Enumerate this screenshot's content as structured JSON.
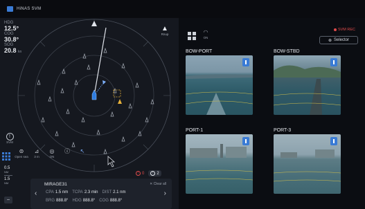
{
  "app": {
    "title": "HiNAS SVM"
  },
  "readouts": [
    {
      "label": "HDG",
      "value": "12.5°",
      "unit": ""
    },
    {
      "label": "COG",
      "value": "30.8°",
      "unit": ""
    },
    {
      "label": "SOG",
      "value": "20.8",
      "unit": "kn"
    }
  ],
  "north": {
    "label": "Rnup"
  },
  "svm": {
    "label": "SVM"
  },
  "toolbar": {
    "items": [
      {
        "icon": "sea-icon",
        "label": "Open sea"
      },
      {
        "icon": "distance-icon",
        "label": "3 m"
      },
      {
        "icon": "camera-icon",
        "label": "ON"
      },
      {
        "icon": "info-icon",
        "label": ""
      },
      {
        "icon": "cursor-icon",
        "label": ""
      }
    ]
  },
  "range": [
    {
      "value": "0.5",
      "unit": "NM"
    },
    {
      "value": "1.5",
      "unit": "NM"
    }
  ],
  "alerts": {
    "red_count": "0",
    "white_count": "2"
  },
  "target": {
    "name": "MIRAGE31",
    "clear_label": "✕ Clear all",
    "rows": [
      [
        {
          "k": "CPA",
          "v": "1.5 nm"
        },
        {
          "k": "TCPA",
          "v": "2.3 min"
        },
        {
          "k": "DIST",
          "v": "2.1 nm"
        }
      ],
      [
        {
          "k": "BRG",
          "v": "888.8°"
        },
        {
          "k": "HDG",
          "v": "888.8°"
        },
        {
          "k": "COG",
          "v": "888.8°"
        }
      ]
    ]
  },
  "right": {
    "on_label": "ON",
    "rec_label": "SVM REC",
    "selector_label": "Selector"
  },
  "cameras": [
    {
      "label": "BOW-PORT"
    },
    {
      "label": "BOW-STBD"
    },
    {
      "label": "PORT-1"
    },
    {
      "label": "PORT-3"
    }
  ],
  "colors": {
    "accent": "#3a7bd5",
    "alert": "#e14b4b",
    "panel": "#15181f",
    "own_ship": "#2e7de0"
  }
}
